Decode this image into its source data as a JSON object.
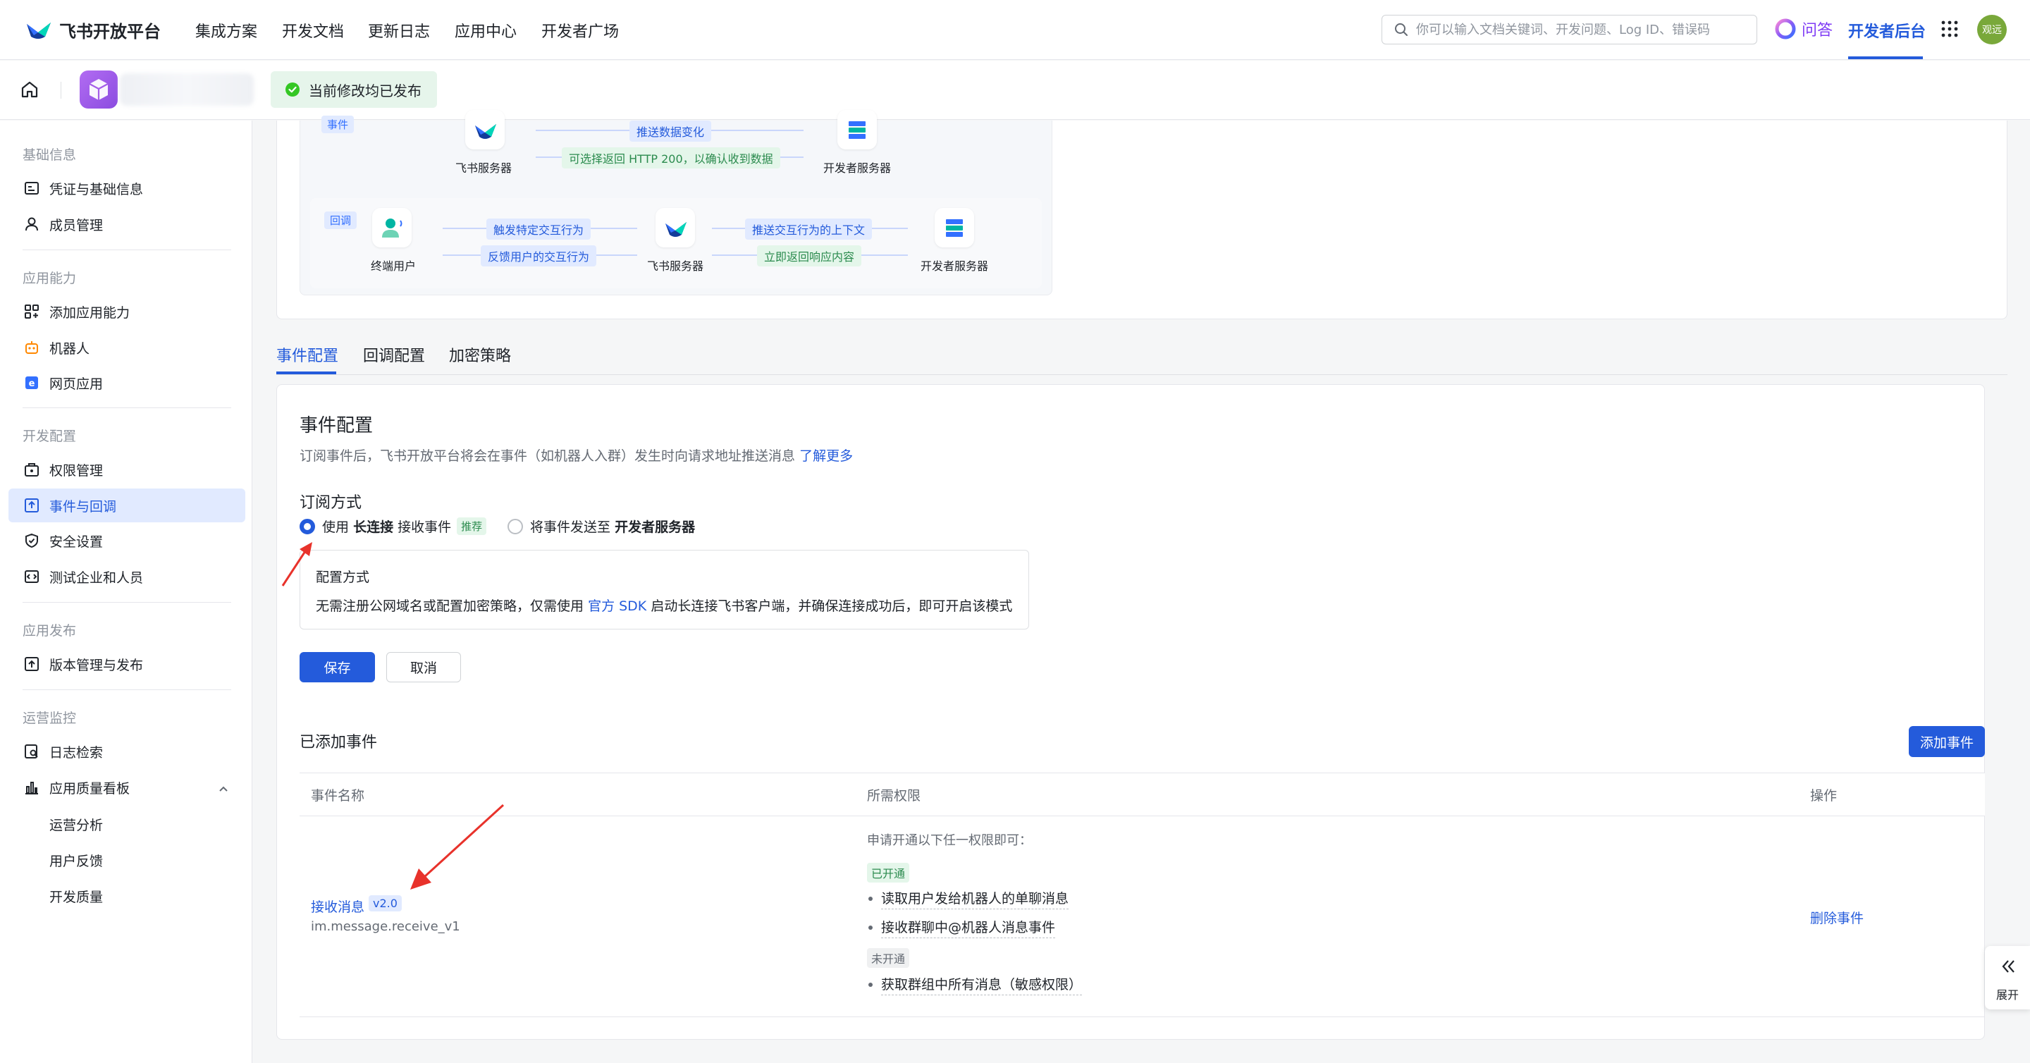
{
  "topnav": {
    "brand": "飞书开放平台",
    "links": [
      "集成方案",
      "开发文档",
      "更新日志",
      "应用中心",
      "开发者广场"
    ],
    "search_placeholder": "你可以输入文档关键词、开发问题、Log ID、错误码",
    "qa_label": "问答",
    "dev_console": "开发者后台",
    "avatar_text": "观远"
  },
  "subheader": {
    "publish_status": "当前修改均已发布"
  },
  "sidebar": {
    "groups": {
      "basic": "基础信息",
      "ability": "应用能力",
      "dev": "开发配置",
      "release": "应用发布",
      "ops": "运营监控"
    },
    "items": {
      "credentials": "凭证与基础信息",
      "members": "成员管理",
      "add_ability": "添加应用能力",
      "bot": "机器人",
      "web_app": "网页应用",
      "permissions": "权限管理",
      "events": "事件与回调",
      "security": "安全设置",
      "test_org": "测试企业和人员",
      "version": "版本管理与发布",
      "logs": "日志检索",
      "quality": "应用质量看板",
      "ops_analysis": "运营分析",
      "feedback": "用户反馈",
      "dev_quality": "开发质量"
    }
  },
  "diagram": {
    "event_tag": "事件",
    "callback_tag": "回调",
    "feishu_server": "飞书服务器",
    "dev_server": "开发者服务器",
    "end_user": "终端用户",
    "push_change": "推送数据变化",
    "http200": "可选择返回 HTTP 200，以确认收到数据",
    "trigger": "触发特定交互行为",
    "feedback": "反馈用户的交互行为",
    "push_context": "推送交互行为的上下文",
    "return_content": "立即返回响应内容"
  },
  "tabs": [
    "事件配置",
    "回调配置",
    "加密策略"
  ],
  "config": {
    "title": "事件配置",
    "desc": "订阅事件后，飞书开放平台将会在事件（如机器人入群）发生时向请求地址推送消息",
    "learn_more": "了解更多",
    "sub_method": "订阅方式",
    "option1_pre": "使用",
    "option1_bold": "长连接",
    "option1_post": "接收事件",
    "recommend": "推荐",
    "option2_pre": "将事件发送至",
    "option2_bold": "开发者服务器",
    "mode_title": "配置方式",
    "mode_desc_pre": "无需注册公网域名或配置加密策略，仅需使用",
    "mode_desc_link": "官方 SDK",
    "mode_desc_post": "启动长连接飞书客户端，并确保连接成功后，即可开启该模式",
    "save": "保存",
    "cancel": "取消"
  },
  "events": {
    "title": "已添加事件",
    "add_button": "添加事件",
    "headers": [
      "事件名称",
      "所需权限",
      "操作"
    ],
    "row": {
      "name": "接收消息",
      "version": "v2.0",
      "key": "im.message.receive_v1",
      "perm_intro": "申请开通以下任一权限即可：",
      "enabled_label": "已开通",
      "enabled": [
        "读取用户发给机器人的单聊消息",
        "接收群聊中@机器人消息事件"
      ],
      "disabled_label": "未开通",
      "disabled": [
        "获取群组中所有消息（敏感权限）"
      ],
      "action": "删除事件"
    }
  },
  "expand_label": "展开",
  "colors": {
    "primary": "#245bdb",
    "success": "#2b8b4e",
    "annotation": "#e8322b"
  }
}
